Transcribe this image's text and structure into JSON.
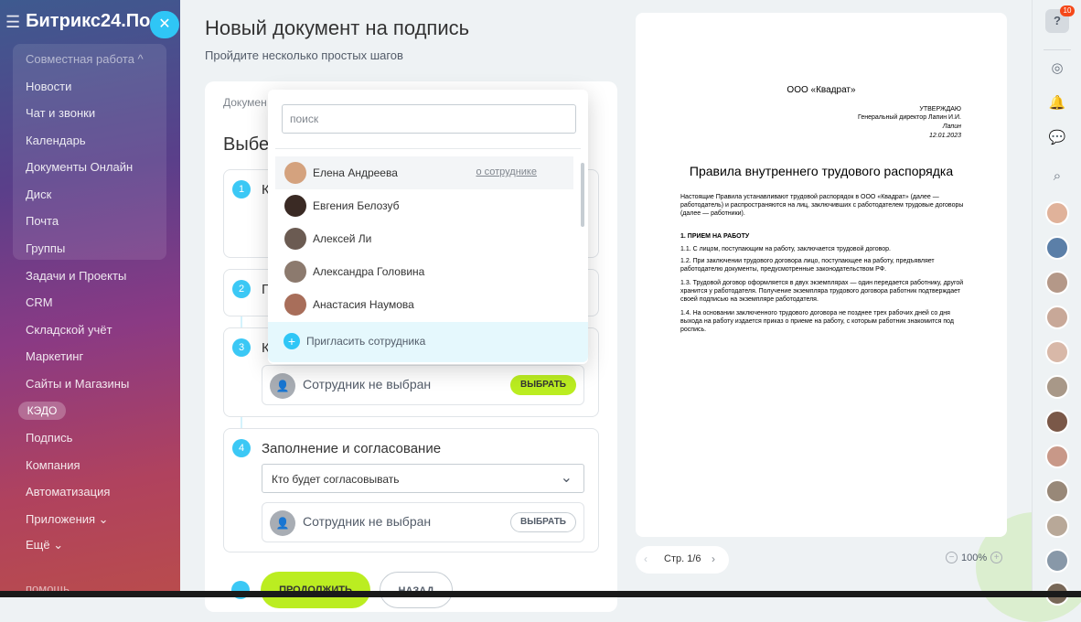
{
  "sidebar": {
    "logo": "Битрикс24.По",
    "group_label": "Совместная работа ^",
    "items": [
      "Новости",
      "Чат и звонки",
      "Календарь",
      "Документы Онлайн",
      "Диск",
      "Почта",
      "Группы",
      "Задачи и Проекты",
      "CRM",
      "Складской учёт",
      "Маркетинг",
      "Сайты и Магазины"
    ],
    "kedo": "КЭДО",
    "items2": [
      "Подпись",
      "Компания",
      "Автоматизация",
      "Приложения ⌄",
      "Ещё ⌄"
    ],
    "footer": "помощь"
  },
  "page": {
    "title": "Новый документ на подпись",
    "subtitle": "Пройдите несколько простых шагов"
  },
  "card": {
    "header": "Докумен",
    "heading": "Выбе",
    "steps": [
      {
        "num": "1",
        "title": "К"
      },
      {
        "num": "2",
        "title": "П"
      },
      {
        "num": "3",
        "title": "К"
      },
      {
        "num": "4",
        "title": "Заполнение и согласование"
      }
    ],
    "employee_not_selected": "Сотрудник не выбран",
    "choose_label": "ВЫБРАТЬ",
    "approver_select": "Кто будет согласовывать",
    "continue_label": "ПРОДОЛЖИТЬ",
    "back_label": "НАЗАД"
  },
  "popup": {
    "search_placeholder": "поиск",
    "people": [
      "Елена Андреева",
      "Евгения Белозуб",
      "Алексей Ли",
      "Александра Головина",
      "Анастасия Наумова"
    ],
    "about_link": "о сотруднике",
    "invite_label": "Пригласить сотрудника"
  },
  "doc": {
    "company": "ООО «Квадрат»",
    "approve": [
      "УТВЕРЖДАЮ",
      "Генеральный директор Лапин И.И.",
      "Лапин",
      "12.01.2023"
    ],
    "title": "Правила внутреннего трудового распорядка",
    "intro": "Настоящие Правила устанавливают трудовой распорядок в ООО «Квадрат» (далее — работодатель) и распространяются на лиц, заключивших с работодателем трудовые договоры (далее — работники).",
    "section": "1. ПРИЕМ НА РАБОТУ",
    "p1": "1.1. С лицом, поступающим на работу, заключается трудовой договор.",
    "p2": "1.2. При заключении трудового договора лицо, поступающее на работу, предъявляет работодателю документы, предусмотренные законодательством РФ.",
    "p3": "1.3. Трудовой договор оформляется в двух экземплярах — один передается работнику, другой хранится у работодателя. Получение экземпляра трудового договора работник подтверждает своей подписью на экземпляре работодателя.",
    "p4": "1.4. На основании заключенного трудового договора не позднее трех рабочих дней со дня выхода на работу издается приказ о приеме на работу, с которым работник знакомится под роспись."
  },
  "pager": {
    "prev": "‹",
    "label": "Стр. 1/6",
    "next": "›"
  },
  "zoom": {
    "minus": "−",
    "value": "100%",
    "plus": "+"
  },
  "right": {
    "help": "?",
    "badge": "10"
  },
  "colors": {
    "accent": "#2fc6f6",
    "green": "#bbed21",
    "badge_red": "#f54819"
  }
}
